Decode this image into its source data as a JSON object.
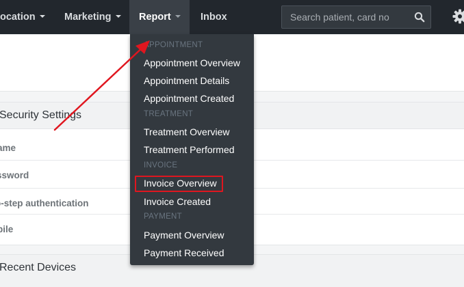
{
  "navbar": {
    "items": [
      {
        "label": "ocation",
        "active": false
      },
      {
        "label": "Marketing",
        "active": false
      },
      {
        "label": "Report",
        "active": true
      },
      {
        "label": "Inbox",
        "active": false
      }
    ],
    "search": {
      "placeholder": "Search patient, card no",
      "icon": "search-icon"
    },
    "settings_icon": "gear-icon"
  },
  "page": {
    "security_settings": {
      "title": "Security Settings",
      "rows": [
        {
          "label": "ername"
        },
        {
          "label": "ssword"
        },
        {
          "label": "o-step authentication"
        },
        {
          "label": "bile"
        }
      ]
    },
    "recent_devices": {
      "title": "Recent Devices"
    }
  },
  "report_menu": {
    "sections": [
      {
        "header": "APPOINTMENT",
        "items": [
          "Appointment Overview",
          "Appointment Details",
          "Appointment Created"
        ]
      },
      {
        "header": "TREATMENT",
        "items": [
          "Treatment Overview",
          "Treatment Performed"
        ]
      },
      {
        "header": "INVOICE",
        "items": [
          "Invoice Overview",
          "Invoice Created"
        ]
      },
      {
        "header": "PAYMENT",
        "items": [
          "Payment Overview",
          "Payment Received"
        ]
      }
    ],
    "highlighted_item": "Invoice Overview"
  },
  "colors": {
    "navbar_bg": "#22272d",
    "menu_bg": "#33393f",
    "menu_header": "#6a7580",
    "annotation": "#e0161f"
  }
}
